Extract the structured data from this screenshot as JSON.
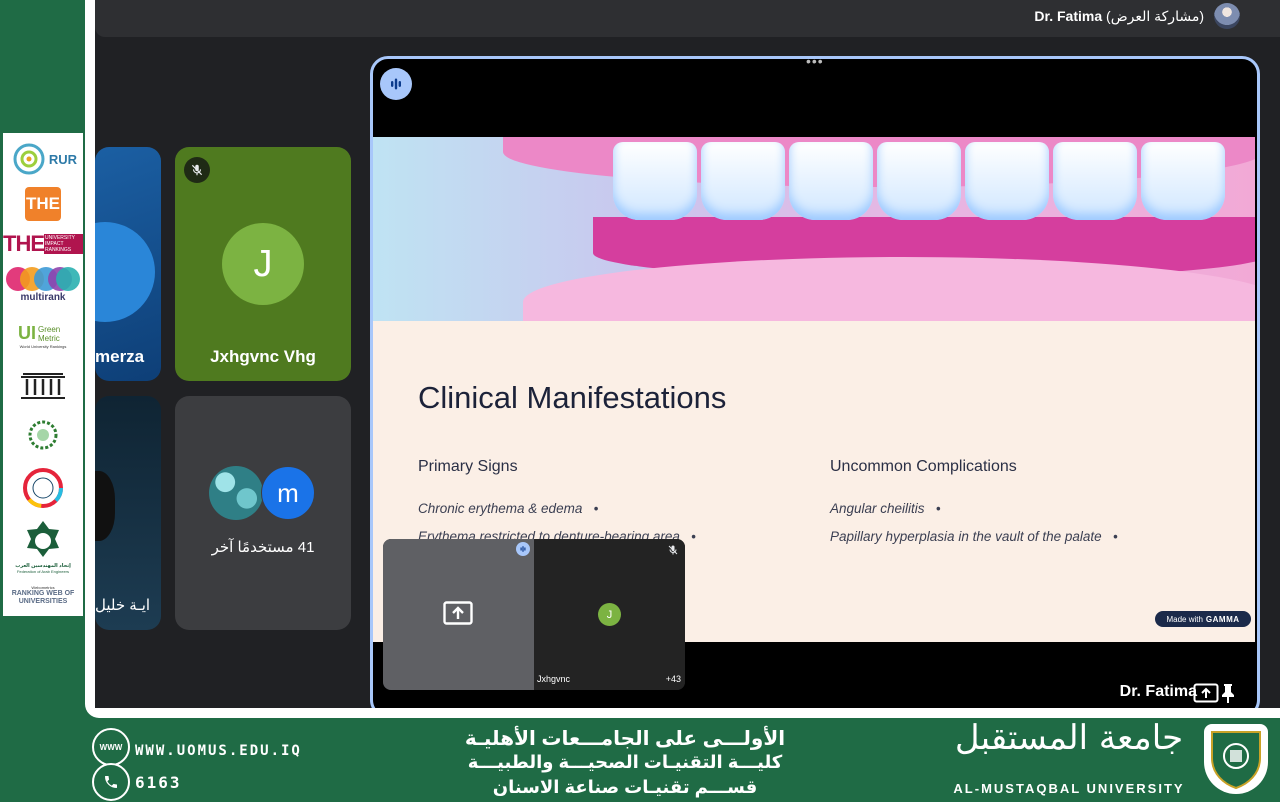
{
  "topbar": {
    "presenter_name": "Dr. Fatima",
    "presenting_label": "(مشاركة العرض)"
  },
  "participants": [
    {
      "name": "merza",
      "avatar_color": "#2a86d8"
    },
    {
      "name": "Jxhgvnc Vhg",
      "initial": "J",
      "avatar_color": "#7cb342",
      "muted": true
    },
    {
      "name": "ايـة خليل"
    },
    {
      "others_label": "41 مستخدمًا آخر",
      "second_initial": "m"
    }
  ],
  "slide": {
    "title": "Clinical Manifestations",
    "left_heading": "Primary Signs",
    "left_items": [
      "Chronic erythema & edema",
      "Erythema restricted to denture-bearing area"
    ],
    "right_heading": "Uncommon Complications",
    "right_items": [
      "Angular cheilitis",
      "Papillary hyperplasia in the vault of the palate"
    ],
    "badge_text": "Made with",
    "badge_brand": "GAMMA",
    "bullet": "•"
  },
  "stage_footer": {
    "presenter_name": "Dr. Fatima"
  },
  "self_view": {
    "name": "Jxhgvnc",
    "initial": "J",
    "extra_count": "+43"
  },
  "rankings": {
    "rur": "RUR",
    "the": "THE",
    "the_impact": "THE",
    "the_impact_sub": "UNIVERSITY IMPACT RANKINGS",
    "multirank": "multirank",
    "greenmetric": "UI",
    "greenmetric_sub": "Green Metric",
    "greenmetric_caption": "World University Rankings",
    "arab_engineers": "إتحاد المهندسين العرب",
    "arab_engineers_en": "Federation of Arab Engineers",
    "webometrics_top": "Webometrics",
    "webometrics": "RANKING WEB OF UNIVERSITIES"
  },
  "footer": {
    "website": "WWW.UOMUS.EDU.IQ",
    "www_icon": "WWW",
    "phone": "6163",
    "line1": "الأولـــى على الجامـــعات الأهليـة",
    "line2": "كليـــة التقنيـات الصحيـــة والطبيـــة",
    "line3": "قســـم تقنيـات صناعة الاسنان",
    "university_ar": "جامعة المستقبل",
    "university_en": "AL-MUSTAQBAL UNIVERSITY"
  },
  "colors": {
    "brand_green": "#1f6b45",
    "meet_bg": "#202124",
    "active_border": "#a8c7fa",
    "slide_bg": "#fbefe6"
  }
}
